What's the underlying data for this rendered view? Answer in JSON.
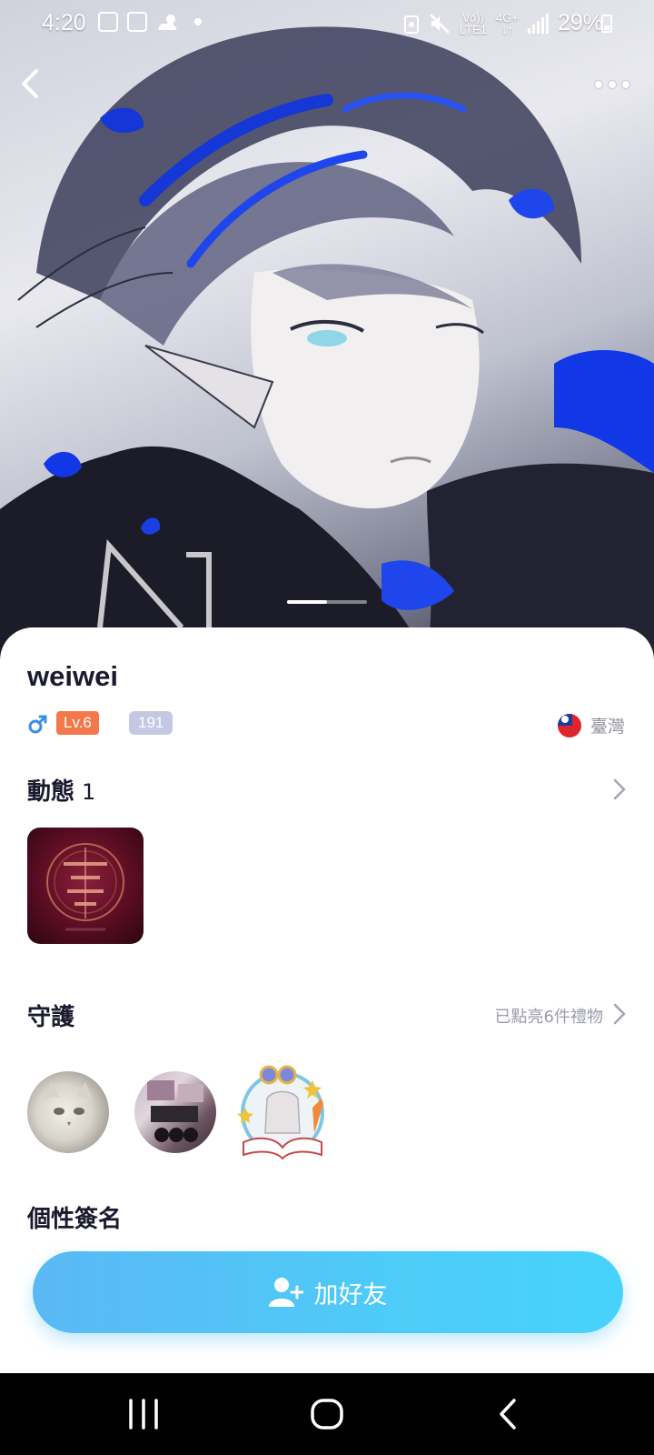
{
  "status_bar": {
    "time": "4:20",
    "network_top": "Vo))",
    "network_bottom": "LTE1",
    "data_label": "4G+",
    "battery": "29%"
  },
  "hero": {
    "photo_count": 2,
    "active_photo": 1
  },
  "profile": {
    "name": "weiwei",
    "gender": "male",
    "level": "Lv.6",
    "count_badge": "191",
    "region": "臺灣"
  },
  "moments": {
    "title": "動態",
    "count": "1"
  },
  "guard": {
    "title": "守護",
    "link": "已點亮6件禮物"
  },
  "signature": {
    "title": "個性簽名"
  },
  "cta": {
    "label": "加好友"
  },
  "colors": {
    "accent": "#4ecbf8",
    "level_badge": "#f4794a",
    "count_badge": "#c5c8e2",
    "gender_male": "#3a8fe8"
  }
}
